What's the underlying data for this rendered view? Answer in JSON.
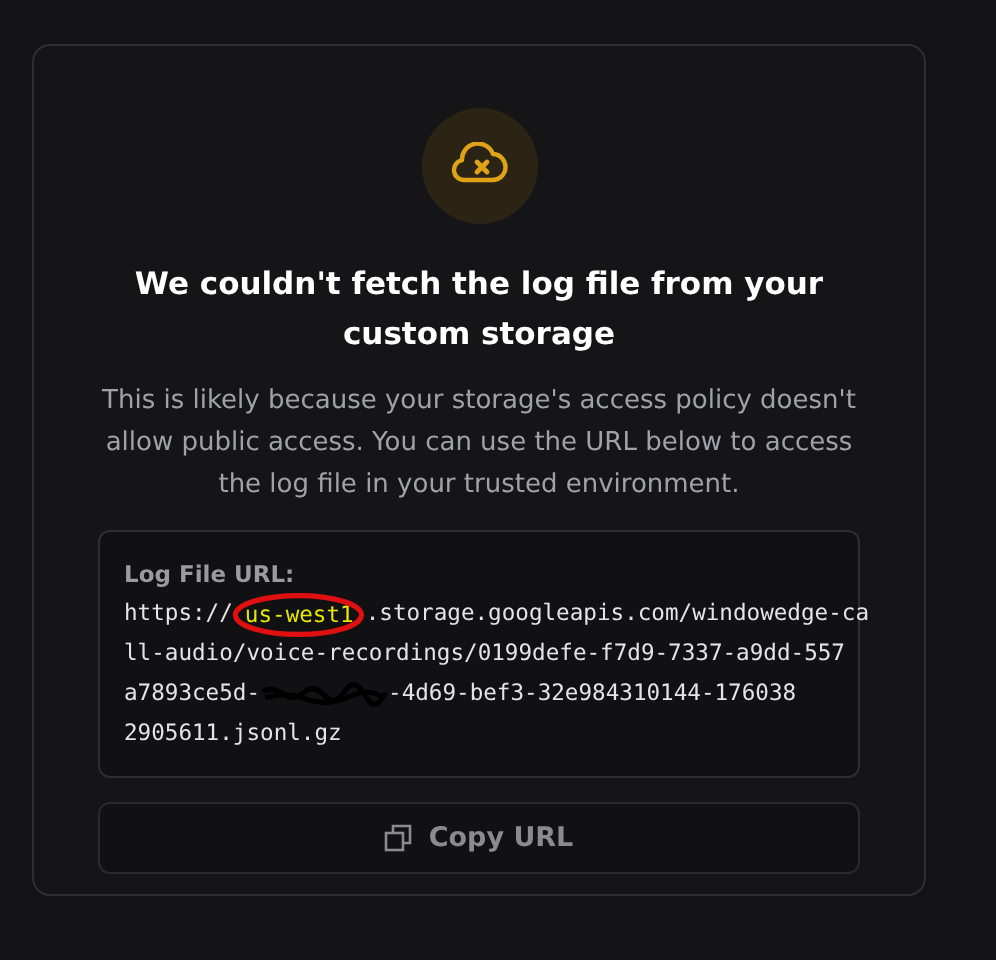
{
  "title": "We couldn't fetch the log file from your custom storage",
  "description": "This is likely because your storage's access policy doesn't allow public access. You can use the URL below to access the log file in your trusted environment.",
  "url_box": {
    "label": "Log File URL:",
    "lines": [
      [
        {
          "kind": "text",
          "text": "https://"
        },
        {
          "kind": "highlight",
          "text": "us-west1"
        },
        {
          "kind": "text",
          "text": ".storage.googleapis.com/windowedge-ca"
        }
      ],
      [
        {
          "kind": "text",
          "text": "ll-audio/voice-recordings/0199defe-f7d9-7337-a9dd-557"
        }
      ],
      [
        {
          "kind": "text",
          "text": "a7893ce5d-"
        },
        {
          "kind": "redacted"
        },
        {
          "kind": "text",
          "text": "-4d69-bef3-32e984310144-176038"
        }
      ],
      [
        {
          "kind": "text",
          "text": "2905611.jsonl.gz"
        }
      ]
    ]
  },
  "copy_button": {
    "label": "Copy URL"
  }
}
